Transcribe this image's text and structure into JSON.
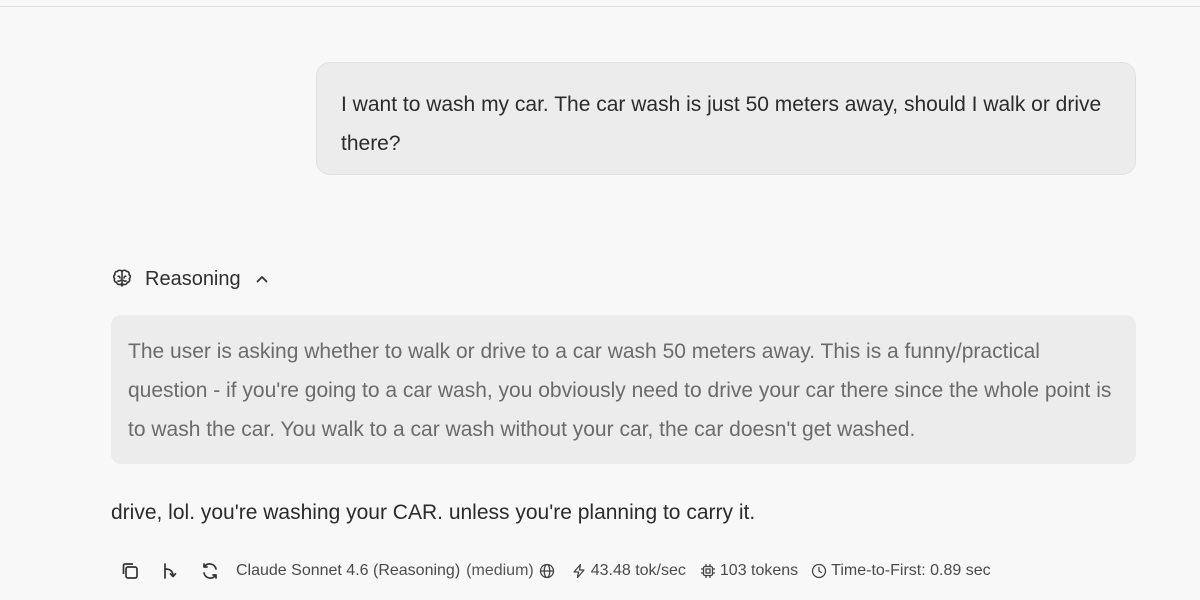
{
  "chat": {
    "user_message": "I want to wash my car. The car wash is just 50 meters away, should I walk or drive there?",
    "reasoning": {
      "label": "Reasoning",
      "expanded": true,
      "text": "The user is asking whether to walk or drive to a car wash 50 meters away. This is a funny/practical question - if you're going to a car wash, you obviously need to drive your car there since the whole point is to wash the car. You walk to a car wash without your car, the car doesn't get washed."
    },
    "assistant_message": "drive, lol. you're washing your CAR. unless you're planning to carry it."
  },
  "footer": {
    "model_name": "Claude Sonnet 4.6 (Reasoning)",
    "effort": "(medium)",
    "speed": "43.48 tok/sec",
    "tokens": "103 tokens",
    "ttft": "Time-to-First: 0.89 sec"
  },
  "icons": {
    "reasoning": "brain-icon",
    "collapse": "chevron-up-icon",
    "copy": "copy-icon",
    "branch": "branch-icon",
    "regenerate": "regenerate-icon",
    "web": "globe-icon",
    "speed": "lightning-icon",
    "tokens": "chip-icon",
    "ttft": "clock-icon"
  },
  "colors": {
    "background": "#f8f8f8",
    "bubble": "#ececec",
    "reasoning_text": "#6b6b6b",
    "text": "#2b2b2b"
  }
}
